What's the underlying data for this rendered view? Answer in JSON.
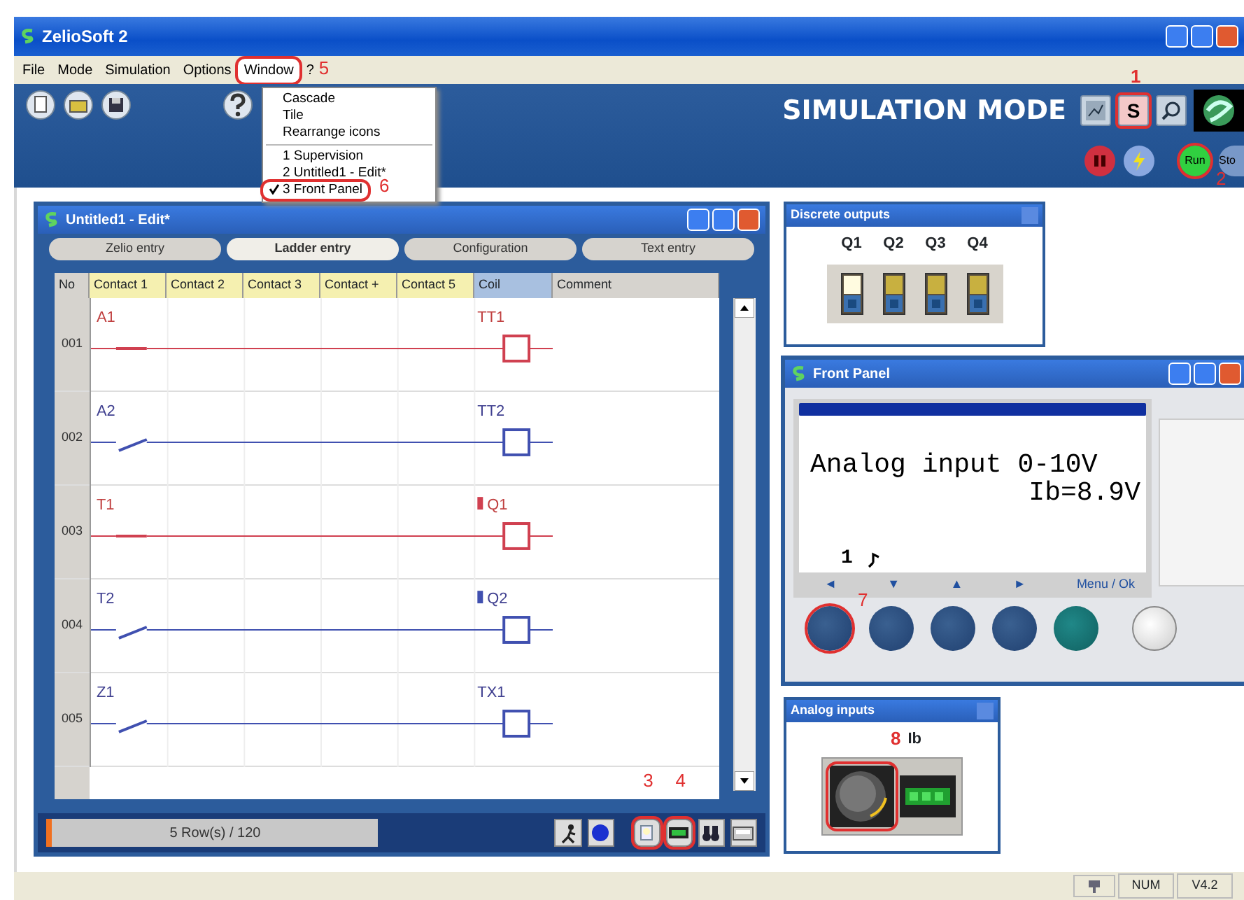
{
  "app": {
    "title": "ZelioSoft 2"
  },
  "menu": [
    {
      "label": "File",
      "open": false
    },
    {
      "label": "Mode",
      "open": false
    },
    {
      "label": "Simulation",
      "open": false
    },
    {
      "label": "Options",
      "open": false
    },
    {
      "label": "Window",
      "open": true,
      "callout": "5"
    },
    {
      "label": "?",
      "open": false
    }
  ],
  "window_menu": [
    {
      "label": "Cascade",
      "kind": "item",
      "checked": false
    },
    {
      "label": "Tile",
      "kind": "item",
      "checked": false
    },
    {
      "label": "Rearrange icons",
      "kind": "item",
      "checked": false
    },
    {
      "kind": "separator"
    },
    {
      "label": "1 Supervision",
      "kind": "item",
      "checked": false
    },
    {
      "label": "2 Untitled1 - Edit*",
      "kind": "item",
      "checked": false
    },
    {
      "label": "3 Front Panel",
      "kind": "item",
      "checked": true,
      "callout": "6"
    }
  ],
  "mode_banner": "SIMULATION MODE",
  "mode_tools": [
    {
      "kind": "chart",
      "selected": false
    },
    {
      "kind": "sim",
      "label": "S",
      "selected": true,
      "callout": "1"
    },
    {
      "kind": "search",
      "selected": false
    },
    {
      "kind": "logo"
    }
  ],
  "run_tools": [
    {
      "kind": "pause"
    },
    {
      "kind": "lightning"
    },
    {
      "kind": "run",
      "label": "Run",
      "callout": "2"
    },
    {
      "kind": "stop",
      "label": "Sto"
    }
  ],
  "editor": {
    "title": "Untitled1 - Edit*",
    "tabs": [
      {
        "label": "Zelio entry",
        "selected": false
      },
      {
        "label": "Ladder entry",
        "selected": true
      },
      {
        "label": "Configuration",
        "selected": false
      },
      {
        "label": "Text entry",
        "selected": false
      }
    ],
    "columns": [
      "No",
      "Contact 1",
      "Contact 2",
      "Contact 3",
      "Contact +",
      "Contact 5",
      "Coil",
      "Comment"
    ],
    "rows": [
      {
        "no": "001",
        "contact": "A1",
        "contact_closed": true,
        "coil": "TT1",
        "energized": true,
        "marker": false
      },
      {
        "no": "002",
        "contact": "A2",
        "contact_closed": false,
        "coil": "TT2",
        "energized": false,
        "marker": false
      },
      {
        "no": "003",
        "contact": "T1",
        "contact_closed": true,
        "coil": "Q1",
        "energized": true,
        "marker": true
      },
      {
        "no": "004",
        "contact": "T2",
        "contact_closed": false,
        "coil": "Q2",
        "energized": false,
        "marker": true
      },
      {
        "no": "005",
        "contact": "Z1",
        "contact_closed": false,
        "coil": "TX1",
        "energized": false,
        "marker": false
      }
    ],
    "row_count": "5 Row(s) / 120",
    "tools": [
      {
        "kind": "walk"
      },
      {
        "kind": "dot"
      },
      {
        "kind": "light",
        "callout": "3"
      },
      {
        "kind": "meter",
        "callout": "4"
      },
      {
        "kind": "binoculars"
      },
      {
        "kind": "panel"
      }
    ]
  },
  "discrete_outputs": {
    "title": "Discrete outputs",
    "outputs": [
      {
        "label": "Q1",
        "on": true
      },
      {
        "label": "Q2",
        "on": false
      },
      {
        "label": "Q3",
        "on": false
      },
      {
        "label": "Q4",
        "on": false
      }
    ]
  },
  "front_panel": {
    "title": "Front Panel",
    "lcd_lines": [
      "Analog input 0-10V",
      "Ib=8.9V"
    ],
    "lcd_status": "1",
    "nav_labels": [
      "◄",
      "▼",
      "▲",
      "►",
      "Menu / Ok"
    ],
    "keys": [
      {
        "kind": "key",
        "callout": "7"
      },
      {
        "kind": "key"
      },
      {
        "kind": "key"
      },
      {
        "kind": "key"
      },
      {
        "kind": "ok"
      },
      {
        "kind": "white"
      }
    ]
  },
  "analog_inputs": {
    "title": "Analog inputs",
    "label": "Ib",
    "callout": "8"
  },
  "status_bar": [
    "NUM",
    "V4.2"
  ]
}
